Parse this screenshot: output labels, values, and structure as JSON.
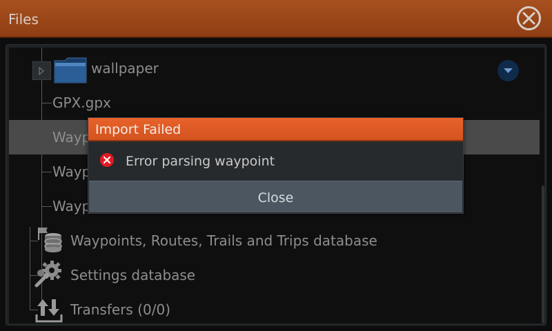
{
  "window": {
    "title": "Files"
  },
  "tree": {
    "items": [
      {
        "label": "wallpaper",
        "type": "folder"
      },
      {
        "label": "GPX.gpx",
        "type": "file"
      },
      {
        "label": "Wayp",
        "type": "file"
      },
      {
        "label": "Wayp",
        "type": "file"
      },
      {
        "label": "Wayp",
        "type": "file"
      },
      {
        "label": "Waypoints, Routes, Trails and Trips database",
        "type": "database"
      },
      {
        "label": "Settings database",
        "type": "settings"
      },
      {
        "label": "Transfers (0/0)",
        "type": "transfers"
      }
    ]
  },
  "dialog": {
    "title": "Import Failed",
    "message": "Error parsing waypoint",
    "button": "Close"
  },
  "colors": {
    "titlebar": "#9b4619",
    "dialog_header": "#e05a25",
    "error": "#e21b23",
    "button": "#4c5660"
  }
}
